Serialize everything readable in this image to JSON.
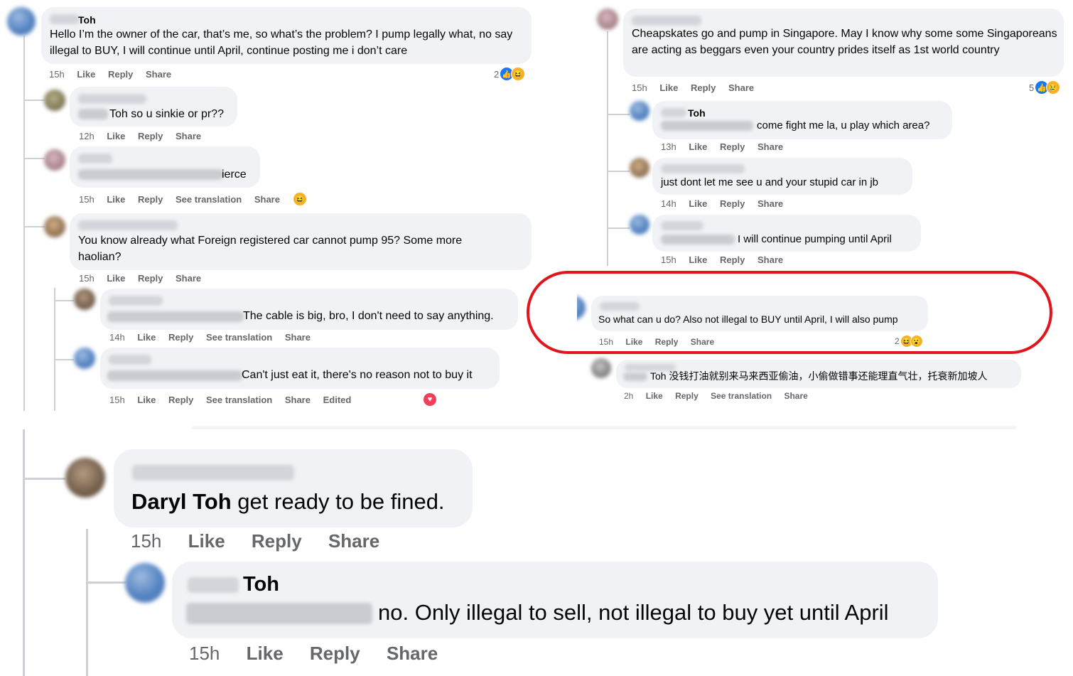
{
  "left_panel": {
    "c1": {
      "name_suffix": "Toh",
      "text": "Hello I’m the owner of the car, that’s me, so what’s the problem? I pump legally what, no say illegal to BUY, I will continue until April, continue posting me i don’t care",
      "time": "15h",
      "like": "Like",
      "reply": "Reply",
      "share": "Share",
      "reaction_count": "2"
    },
    "c2": {
      "text": "Toh so u sinkie or pr??",
      "time": "12h",
      "like": "Like",
      "reply": "Reply",
      "share": "Share"
    },
    "c3": {
      "text": "ierce",
      "time": "15h",
      "like": "Like",
      "reply": "Reply",
      "see_translation": "See translation",
      "share": "Share"
    },
    "c4": {
      "text": "You know already what Foreign registered car cannot pump 95? Some more haolian?",
      "time": "15h",
      "like": "Like",
      "reply": "Reply",
      "share": "Share"
    },
    "c5": {
      "text": "The cable is big, bro, I don't need to say anything.",
      "time": "14h",
      "like": "Like",
      "reply": "Reply",
      "see_translation": "See translation",
      "share": "Share"
    },
    "c6": {
      "text": "Can't just eat it, there's no reason not to buy it",
      "time": "15h",
      "like": "Like",
      "reply": "Reply",
      "see_translation": "See translation",
      "share": "Share",
      "edited": "Edited"
    }
  },
  "right_panel": {
    "c1": {
      "text": "Cheapskates go and pump in Singapore. May I know why some some Singaporeans are acting as beggars even your country prides itself as 1st world country",
      "time": "15h",
      "like": "Like",
      "reply": "Reply",
      "share": "Share",
      "reaction_count": "5"
    },
    "c2": {
      "name_suffix": "Toh",
      "text": "come fight me la, u play which area?",
      "time": "13h",
      "like": "Like",
      "reply": "Reply",
      "share": "Share"
    },
    "c3": {
      "text": "just dont let me see u and your stupid car in jb",
      "time": "14h",
      "like": "Like",
      "reply": "Reply",
      "share": "Share"
    },
    "c4": {
      "text": "I will continue pumping until April",
      "time": "15h",
      "like": "Like",
      "reply": "Reply",
      "share": "Share"
    },
    "c5": {
      "text": "So what can u do? Also not illegal to BUY until April, I will also pump",
      "time": "15h",
      "like": "Like",
      "reply": "Reply",
      "share": "Share",
      "reaction_count": "2"
    },
    "c6": {
      "text": "Toh 没钱打油就别来马来西亚偷油，小偷做错事还能理直气壮，托衰新加坡人",
      "time": "2h",
      "like": "Like",
      "reply": "Reply",
      "see_translation": "See translation",
      "share": "Share"
    }
  },
  "bottom_panel": {
    "c1": {
      "mention": "Daryl Toh",
      "text": " get ready to be fined.",
      "time": "15h",
      "like": "Like",
      "reply": "Reply",
      "share": "Share"
    },
    "c2": {
      "name_suffix": "Toh",
      "text": "no. Only illegal to sell, not illegal to buy yet until April",
      "time": "15h",
      "like": "Like",
      "reply": "Reply",
      "share": "Share"
    }
  },
  "colors": {
    "highlight": "#e0161e",
    "bubble": "#f0f2f5",
    "action_text": "#65676b",
    "like_blue": "#1877f2"
  }
}
